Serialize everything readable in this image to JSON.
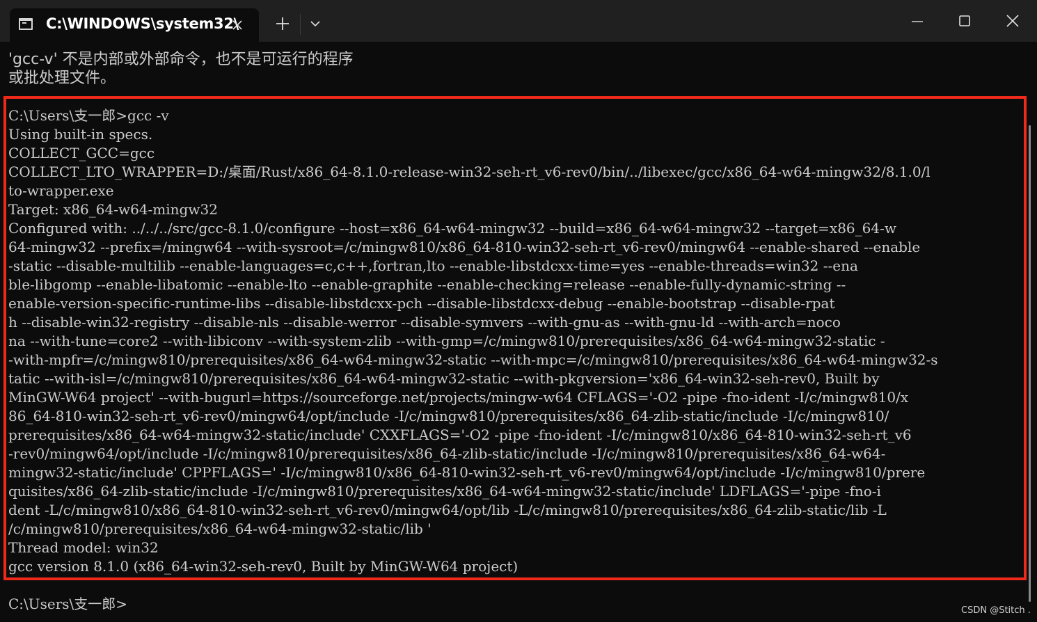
{
  "window": {
    "tab_title": "C:\\WINDOWS\\system32\\",
    "tab_icon": "terminal-icon",
    "new_tab_icon": "plus-icon",
    "dropdown_icon": "chevron-down-icon",
    "minimize_icon": "minimize-icon",
    "maximize_icon": "maximize-icon",
    "close_icon": "close-icon"
  },
  "terminal": {
    "error_lines": [
      "'gcc-v' 不是内部或外部命令，也不是可运行的程序",
      "或批处理文件。"
    ],
    "output_lines": [
      "C:\\Users\\支一郎>gcc -v",
      "Using built-in specs.",
      "COLLECT_GCC=gcc",
      "COLLECT_LTO_WRAPPER=D:/桌面/Rust/x86_64-8.1.0-release-win32-seh-rt_v6-rev0/bin/../libexec/gcc/x86_64-w64-mingw32/8.1.0/l",
      "to-wrapper.exe",
      "Target: x86_64-w64-mingw32",
      "Configured with: ../../../src/gcc-8.1.0/configure --host=x86_64-w64-mingw32 --build=x86_64-w64-mingw32 --target=x86_64-w",
      "64-mingw32 --prefix=/mingw64 --with-sysroot=/c/mingw810/x86_64-810-win32-seh-rt_v6-rev0/mingw64 --enable-shared --enable",
      "-static --disable-multilib --enable-languages=c,c++,fortran,lto --enable-libstdcxx-time=yes --enable-threads=win32 --ena",
      "ble-libgomp --enable-libatomic --enable-lto --enable-graphite --enable-checking=release --enable-fully-dynamic-string --",
      "enable-version-specific-runtime-libs --disable-libstdcxx-pch --disable-libstdcxx-debug --enable-bootstrap --disable-rpat",
      "h --disable-win32-registry --disable-nls --disable-werror --disable-symvers --with-gnu-as --with-gnu-ld --with-arch=noco",
      "na --with-tune=core2 --with-libiconv --with-system-zlib --with-gmp=/c/mingw810/prerequisites/x86_64-w64-mingw32-static -",
      "-with-mpfr=/c/mingw810/prerequisites/x86_64-w64-mingw32-static --with-mpc=/c/mingw810/prerequisites/x86_64-w64-mingw32-s",
      "tatic --with-isl=/c/mingw810/prerequisites/x86_64-w64-mingw32-static --with-pkgversion='x86_64-win32-seh-rev0, Built by",
      "MinGW-W64 project' --with-bugurl=https://sourceforge.net/projects/mingw-w64 CFLAGS='-O2 -pipe -fno-ident -I/c/mingw810/x",
      "86_64-810-win32-seh-rt_v6-rev0/mingw64/opt/include -I/c/mingw810/prerequisites/x86_64-zlib-static/include -I/c/mingw810/",
      "prerequisites/x86_64-w64-mingw32-static/include' CXXFLAGS='-O2 -pipe -fno-ident -I/c/mingw810/x86_64-810-win32-seh-rt_v6",
      "-rev0/mingw64/opt/include -I/c/mingw810/prerequisites/x86_64-zlib-static/include -I/c/mingw810/prerequisites/x86_64-w64-",
      "mingw32-static/include' CPPFLAGS=' -I/c/mingw810/x86_64-810-win32-seh-rt_v6-rev0/mingw64/opt/include -I/c/mingw810/prere",
      "quisites/x86_64-zlib-static/include -I/c/mingw810/prerequisites/x86_64-w64-mingw32-static/include' LDFLAGS='-pipe -fno-i",
      "dent -L/c/mingw810/x86_64-810-win32-seh-rt_v6-rev0/mingw64/opt/lib -L/c/mingw810/prerequisites/x86_64-zlib-static/lib -L",
      "/c/mingw810/prerequisites/x86_64-w64-mingw32-static/lib '",
      "Thread model: win32",
      "gcc version 8.1.0 (x86_64-win32-seh-rev0, Built by MinGW-W64 project)"
    ],
    "prompt": "C:\\Users\\支一郎>"
  },
  "colors": {
    "terminal_bg": "#0c0c0c",
    "terminal_text": "#cccccc",
    "titlebar_bg": "#202020",
    "highlight_border": "#ef2a1a"
  },
  "watermark": "CSDN @Stitch ."
}
